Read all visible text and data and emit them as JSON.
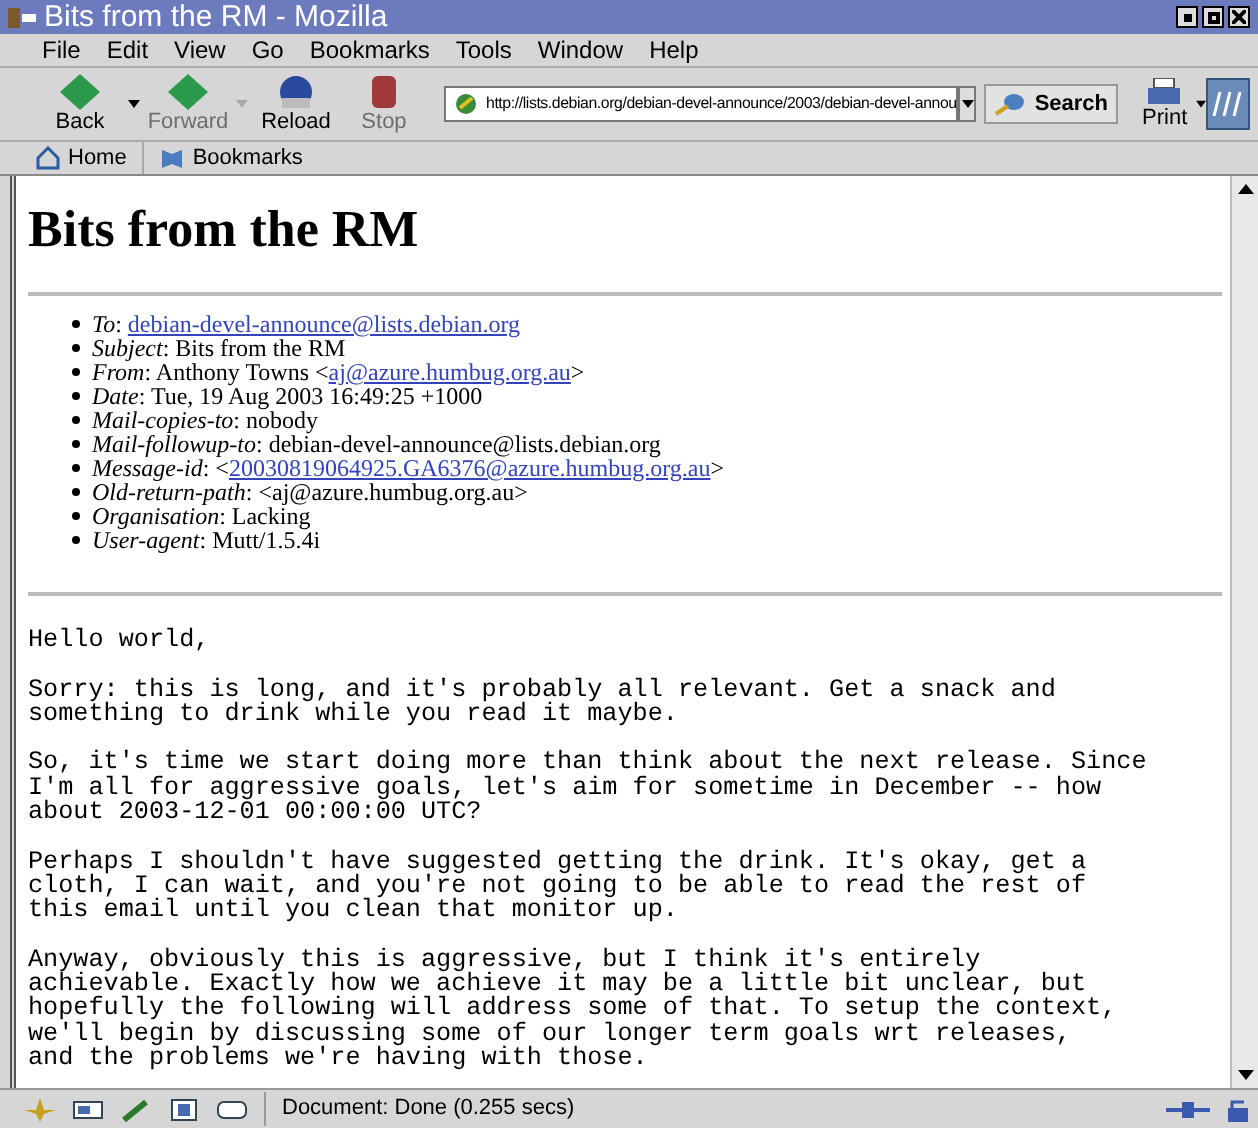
{
  "window": {
    "title": "Bits from the RM - Mozilla"
  },
  "menu": [
    "File",
    "Edit",
    "View",
    "Go",
    "Bookmarks",
    "Tools",
    "Window",
    "Help"
  ],
  "toolbar": {
    "buttons": [
      {
        "label": "Back",
        "disabled": false
      },
      {
        "label": "Forward",
        "disabled": true
      },
      {
        "label": "Reload",
        "disabled": false
      },
      {
        "label": "Stop",
        "disabled": true
      }
    ],
    "url": "http://lists.debian.org/debian-devel-announce/2003/debian-devel-annou",
    "search": "Search",
    "print": "Print"
  },
  "personal_bar": [
    "Home",
    "Bookmarks"
  ],
  "page": {
    "heading": "Bits from the RM",
    "headers": [
      {
        "label": "To",
        "text": ": ",
        "link": "debian-devel-announce@lists.debian.org"
      },
      {
        "label": "Subject",
        "text": ": Bits from the RM"
      },
      {
        "label": "From",
        "text": ": Anthony Towns <",
        "link": "aj@azure.humbug.org.au",
        "suffix": ">"
      },
      {
        "label": "Date",
        "text": ": Tue, 19 Aug 2003 16:49:25 +1000"
      },
      {
        "label": "Mail-copies-to",
        "text": ": nobody"
      },
      {
        "label": "Mail-followup-to",
        "text": ": debian-devel-announce@lists.debian.org"
      },
      {
        "label": "Message-id",
        "text": ": <",
        "link": "20030819064925.GA6376@azure.humbug.org.au",
        "suffix": ">"
      },
      {
        "label": "Old-return-path",
        "text": ": <aj@azure.humbug.org.au>"
      },
      {
        "label": "Organisation",
        "text": ": Lacking"
      },
      {
        "label": "User-agent",
        "text": ": Mutt/1.5.4i"
      }
    ],
    "body": [
      [
        "Hello world,"
      ],
      [
        "Sorry: this is long, and it's probably all relevant. Get a snack and",
        "something to drink while you read it maybe."
      ],
      [
        "So, it's time we start doing more than think about the next release. Since",
        "I'm all for aggressive goals, let's aim for sometime in December -- how",
        "about 2003-12-01 00:00:00 UTC?"
      ],
      [
        "Perhaps I shouldn't have suggested getting the drink. It's okay, get a",
        "cloth, I can wait, and you're not going to be able to read the rest of",
        "this email until you clean that monitor up."
      ],
      [
        "Anyway, obviously this is aggressive, but I think it's entirely",
        "achievable. Exactly how we achieve it may be a little bit unclear, but",
        "hopefully the following will address some of that. To setup the context,",
        "we'll begin by discussing some of our longer term goals wrt releases,",
        "and the problems we're having with those."
      ]
    ]
  },
  "status_bar": {
    "text": "Document: Done (0.255 secs)"
  }
}
